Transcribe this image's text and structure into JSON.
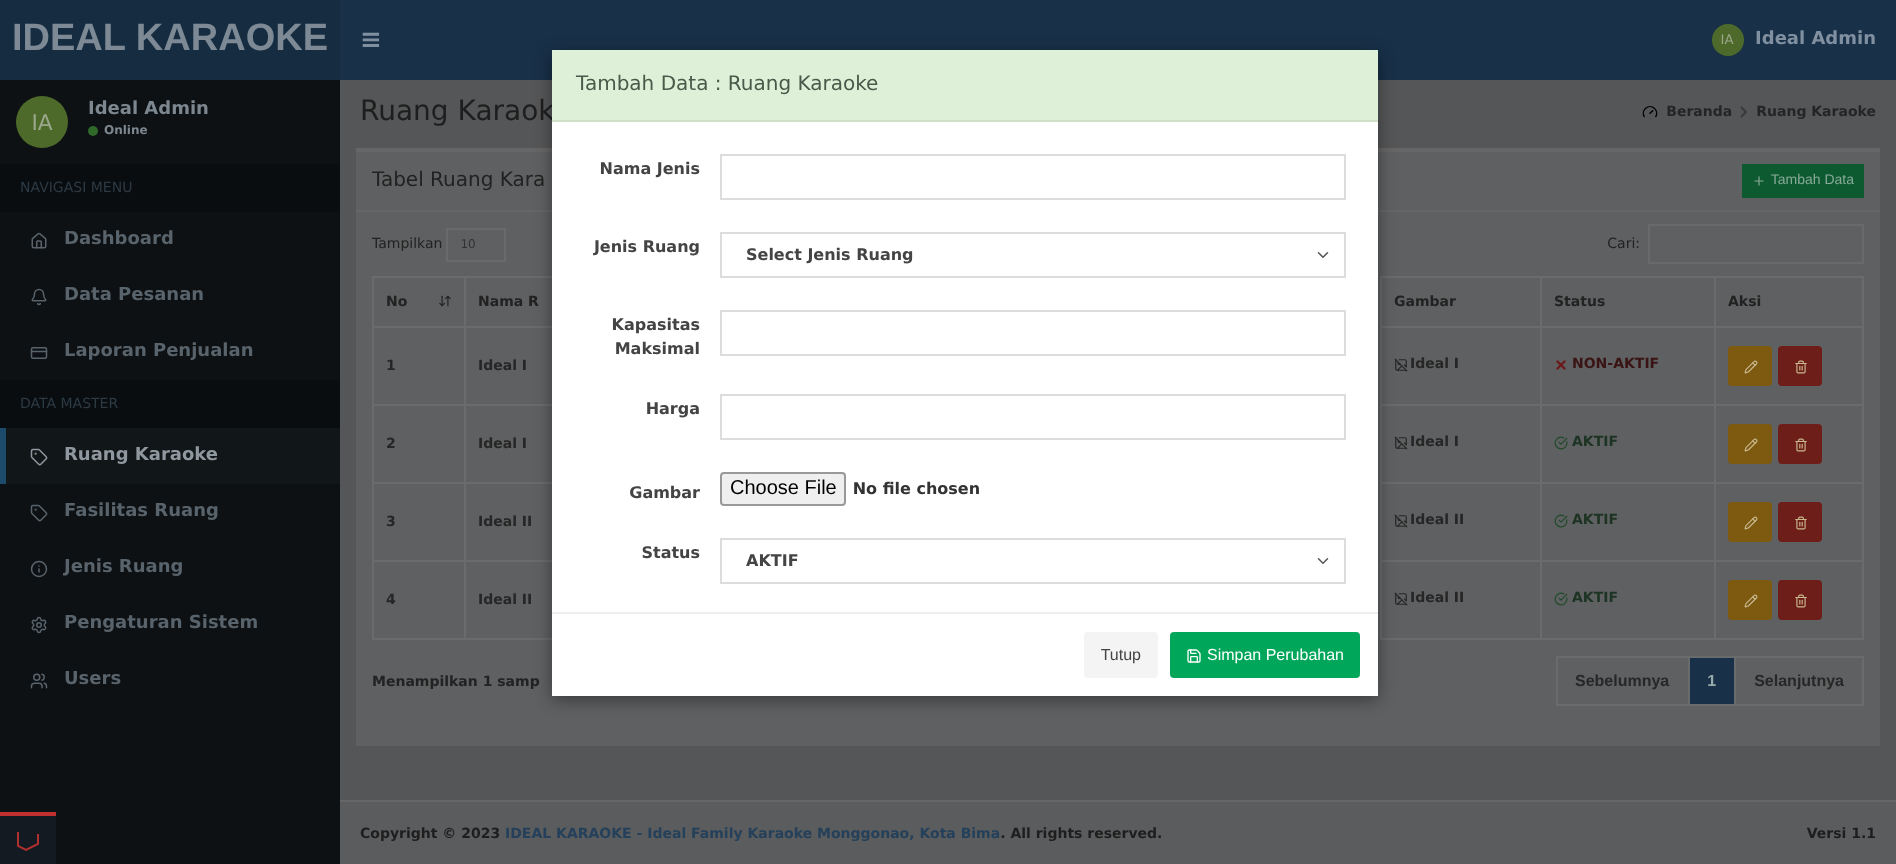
{
  "brand": "IDEAL KARAOKE",
  "topbar": {
    "menu_glyph": "≡",
    "avatar": "IA",
    "user": "Ideal Admin"
  },
  "sidebar": {
    "avatar": "IA",
    "user": "Ideal Admin",
    "status": "Online",
    "sections": [
      {
        "header": "NAVIGASI MENU",
        "items": [
          {
            "label": "Dashboard",
            "selected": false
          },
          {
            "label": "Data Pesanan",
            "selected": false
          },
          {
            "label": "Laporan Penjualan",
            "selected": false
          }
        ]
      },
      {
        "header": "DATA MASTER",
        "items": [
          {
            "label": "Ruang Karaoke",
            "selected": true
          },
          {
            "label": "Fasilitas Ruang",
            "selected": false
          },
          {
            "label": "Jenis Ruang",
            "selected": false
          },
          {
            "label": "Pengaturan Sistem",
            "selected": false
          },
          {
            "label": "Users",
            "selected": false
          }
        ]
      }
    ]
  },
  "page": {
    "title": "Ruang Karaok",
    "breadcrumb": [
      "Beranda",
      "Ruang Karaoke"
    ]
  },
  "panel": {
    "title": "Tabel Ruang Kara",
    "add_button": "Tambah Data",
    "show_label": "Tampilkan",
    "show_value": "10",
    "search_label": "Cari:",
    "columns": [
      "No",
      "Nama R",
      "Gambar",
      "Status",
      "Aksi"
    ],
    "rows": [
      {
        "no": "1",
        "name": "Ideal I",
        "image_alt": "Ideal I",
        "status": "NON-AKTIF",
        "active": false
      },
      {
        "no": "2",
        "name": "Ideal I",
        "image_alt": "Ideal I",
        "status": "AKTIF",
        "active": true
      },
      {
        "no": "3",
        "name": "Ideal II",
        "image_alt": "Ideal II",
        "status": "AKTIF",
        "active": true
      },
      {
        "no": "4",
        "name": "Ideal II",
        "image_alt": "Ideal II",
        "status": "AKTIF",
        "active": true
      }
    ],
    "info": "Menampilkan 1 samp",
    "pagination": [
      {
        "label": "Sebelumnya",
        "selected": false
      },
      {
        "label": "1",
        "selected": true
      },
      {
        "label": "Selanjutnya",
        "selected": false
      }
    ]
  },
  "footer": {
    "prefix": "Copyright © 2023",
    "link": "IDEAL KARAOKE - Ideal Family Karaoke Monggonao, Kota Bima",
    "suffix": ". All rights reserved.",
    "version": "Versi 1.1"
  },
  "modal": {
    "title": "Tambah Data : Ruang Karaoke",
    "fields": [
      {
        "kind": "text",
        "label": "Nama Jenis"
      },
      {
        "kind": "select",
        "label": "Jenis Ruang",
        "value": "Select Jenis Ruang"
      },
      {
        "kind": "text",
        "label": "Kapasitas Maksimal"
      },
      {
        "kind": "text",
        "label": "Harga"
      },
      {
        "kind": "file",
        "label": "Gambar",
        "button": "Choose File",
        "value": "No file chosen"
      },
      {
        "kind": "select",
        "label": "Status",
        "value": "AKTIF"
      }
    ],
    "buttons": [
      {
        "kind": "default",
        "label": "Tutup"
      },
      {
        "kind": "primary",
        "label": "Simpan Perubahan"
      }
    ]
  }
}
